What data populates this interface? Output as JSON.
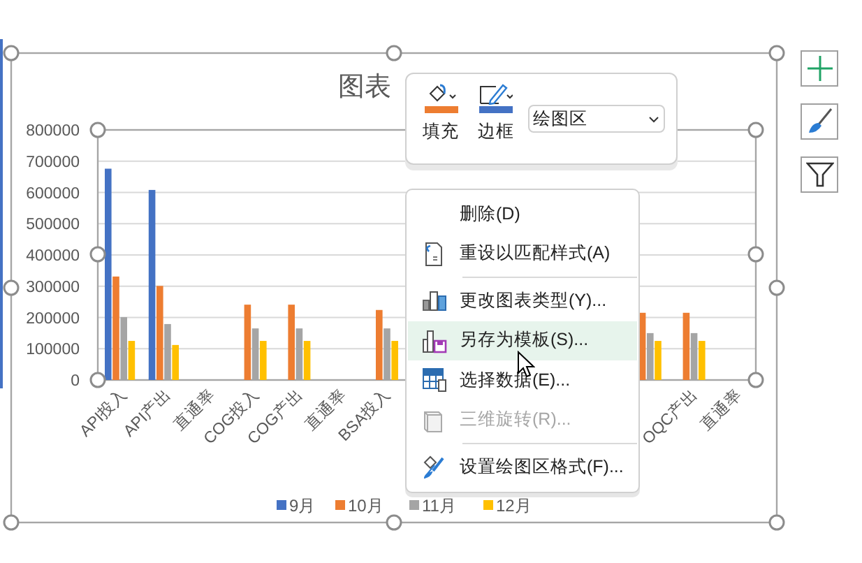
{
  "chart": {
    "title": "图表",
    "chart_data": {
      "type": "bar",
      "categories": [
        "API投入",
        "API产出",
        "直通率",
        "COG投入",
        "COG产出",
        "直通率",
        "BSA投入",
        null,
        null,
        null,
        null,
        null,
        null,
        "OQC产出",
        "直通率"
      ],
      "series": [
        {
          "name": "9月",
          "color": "#4472c4",
          "values": [
            676000,
            608000,
            null,
            null,
            null,
            null,
            null,
            null,
            null,
            null,
            null,
            null,
            null,
            null,
            null
          ]
        },
        {
          "name": "10月",
          "color": "#ed7d31",
          "values": [
            331000,
            301000,
            null,
            241000,
            241000,
            null,
            224000,
            null,
            null,
            null,
            null,
            null,
            215000,
            215000,
            null
          ]
        },
        {
          "name": "11月",
          "color": "#a5a5a5",
          "values": [
            201000,
            179000,
            null,
            165000,
            165000,
            null,
            165000,
            null,
            null,
            null,
            null,
            null,
            150000,
            150000,
            null
          ]
        },
        {
          "name": "12月",
          "color": "#ffc000",
          "values": [
            125000,
            112000,
            null,
            125000,
            125000,
            null,
            125000,
            null,
            null,
            null,
            null,
            null,
            125000,
            125000,
            null
          ]
        }
      ],
      "grid": true,
      "legend": true,
      "ylim": [
        0,
        800000
      ],
      "yticks": [
        0,
        100000,
        200000,
        300000,
        400000,
        500000,
        600000,
        700000,
        800000
      ]
    }
  },
  "mini_toolbar": {
    "fill": {
      "label": "填充",
      "color": "#ed7d31"
    },
    "outline": {
      "label": "边框",
      "color": "#4472c4"
    },
    "element_select": {
      "value": "绘图区"
    }
  },
  "context_menu": [
    {
      "kind": "item",
      "label": "删除(D)",
      "disabled": false,
      "selected": false
    },
    {
      "kind": "item",
      "label": "重设以匹配样式(A)",
      "disabled": false,
      "selected": false
    },
    {
      "kind": "separator"
    },
    {
      "kind": "item",
      "label": "更改图表类型(Y)...",
      "disabled": false,
      "selected": false
    },
    {
      "kind": "item",
      "label": "另存为模板(S)...",
      "disabled": false,
      "selected": true
    },
    {
      "kind": "item",
      "label": "选择数据(E)...",
      "disabled": false,
      "selected": false
    },
    {
      "kind": "item",
      "label": "三维旋转(R)...",
      "disabled": true,
      "selected": false
    },
    {
      "kind": "separator"
    },
    {
      "kind": "item",
      "label": "设置绘图区格式(F)...",
      "disabled": false,
      "selected": false
    }
  ]
}
